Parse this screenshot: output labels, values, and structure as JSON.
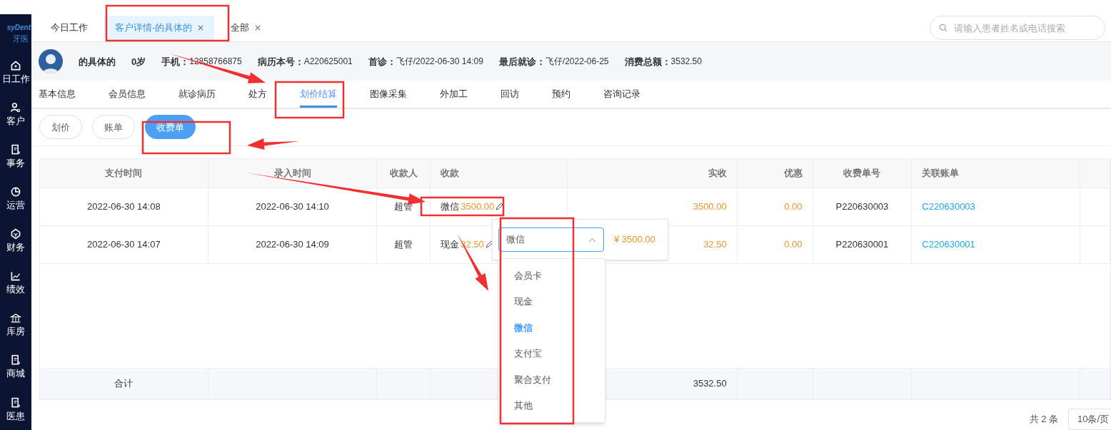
{
  "sidebar": {
    "logo": {
      "text": "syDent",
      "subtext": "牙医"
    },
    "items": [
      {
        "label": "日工作",
        "selected": false
      },
      {
        "label": "客户",
        "selected": false
      },
      {
        "label": "事务",
        "selected": false
      },
      {
        "label": "运营",
        "selected": false
      },
      {
        "label": "财务",
        "selected": false
      },
      {
        "label": "绩效",
        "selected": false
      },
      {
        "label": "库房",
        "selected": false
      },
      {
        "label": "商城",
        "selected": false
      },
      {
        "label": "医患",
        "selected": false
      }
    ]
  },
  "page_tabs": [
    {
      "label": "今日工作",
      "closable": false,
      "selected": false
    },
    {
      "label": "客户详情-的具体的",
      "closable": true,
      "selected": true
    },
    {
      "label": "全部",
      "closable": true,
      "selected": false
    }
  ],
  "search": {
    "placeholder": "请输入患者姓名或电话搜索"
  },
  "patient": {
    "name": "的具体的",
    "age": "0岁",
    "fields": [
      {
        "label": "手机：",
        "value": "12858766875"
      },
      {
        "label": "病历本号：",
        "value": "A220625001"
      },
      {
        "label": "首诊：",
        "value": "飞仔/2022-06-30 14:09"
      },
      {
        "label": "最后就诊：",
        "value": "飞仔/2022-06-25"
      },
      {
        "label": "消费总额：",
        "value": "3532.50"
      }
    ]
  },
  "detail_tabs": [
    {
      "label": "基本信息",
      "selected": false
    },
    {
      "label": "会员信息",
      "selected": false
    },
    {
      "label": "就诊病历",
      "selected": false
    },
    {
      "label": "处方",
      "selected": false
    },
    {
      "label": "划价结算",
      "selected": true
    },
    {
      "label": "图像采集",
      "selected": false
    },
    {
      "label": "外加工",
      "selected": false
    },
    {
      "label": "回访",
      "selected": false
    },
    {
      "label": "预约",
      "selected": false
    },
    {
      "label": "咨询记录",
      "selected": false
    }
  ],
  "sub_tabs": [
    {
      "label": "划价",
      "selected": false
    },
    {
      "label": "账单",
      "selected": false
    },
    {
      "label": "收费单",
      "selected": true
    }
  ],
  "table": {
    "columns": [
      "支付时间",
      "录入时间",
      "收款人",
      "收款",
      "实收",
      "优惠",
      "收费单号",
      "关联账单"
    ],
    "rows": [
      {
        "paid_at": "2022-06-30 14:08",
        "entered_at": "2022-06-30 14:10",
        "payee": "超管",
        "method": "微信",
        "amount": "3500.00",
        "received": "3500.00",
        "discount": "0.00",
        "receipt_no": "P220630003",
        "bill": "C220630003"
      },
      {
        "paid_at": "2022-06-30 14:07",
        "entered_at": "2022-06-30 14:09",
        "payee": "超管",
        "method": "现金",
        "amount": "32.50",
        "received": "32.50",
        "discount": "0.00",
        "receipt_no": "P220630001",
        "bill": "C220630001"
      }
    ],
    "total": {
      "label": "合计",
      "received": "3532.50"
    }
  },
  "edit_popover": {
    "select_value": "微信",
    "amount": "¥ 3500.00",
    "options": [
      {
        "label": "会员卡",
        "selected": false
      },
      {
        "label": "现金",
        "selected": false
      },
      {
        "label": "微信",
        "selected": true
      },
      {
        "label": "支付宝",
        "selected": false
      },
      {
        "label": "聚合支付",
        "selected": false
      },
      {
        "label": "其他",
        "selected": false
      }
    ]
  },
  "pagination": {
    "total": "共 2 条",
    "page_size": "10条/页"
  }
}
